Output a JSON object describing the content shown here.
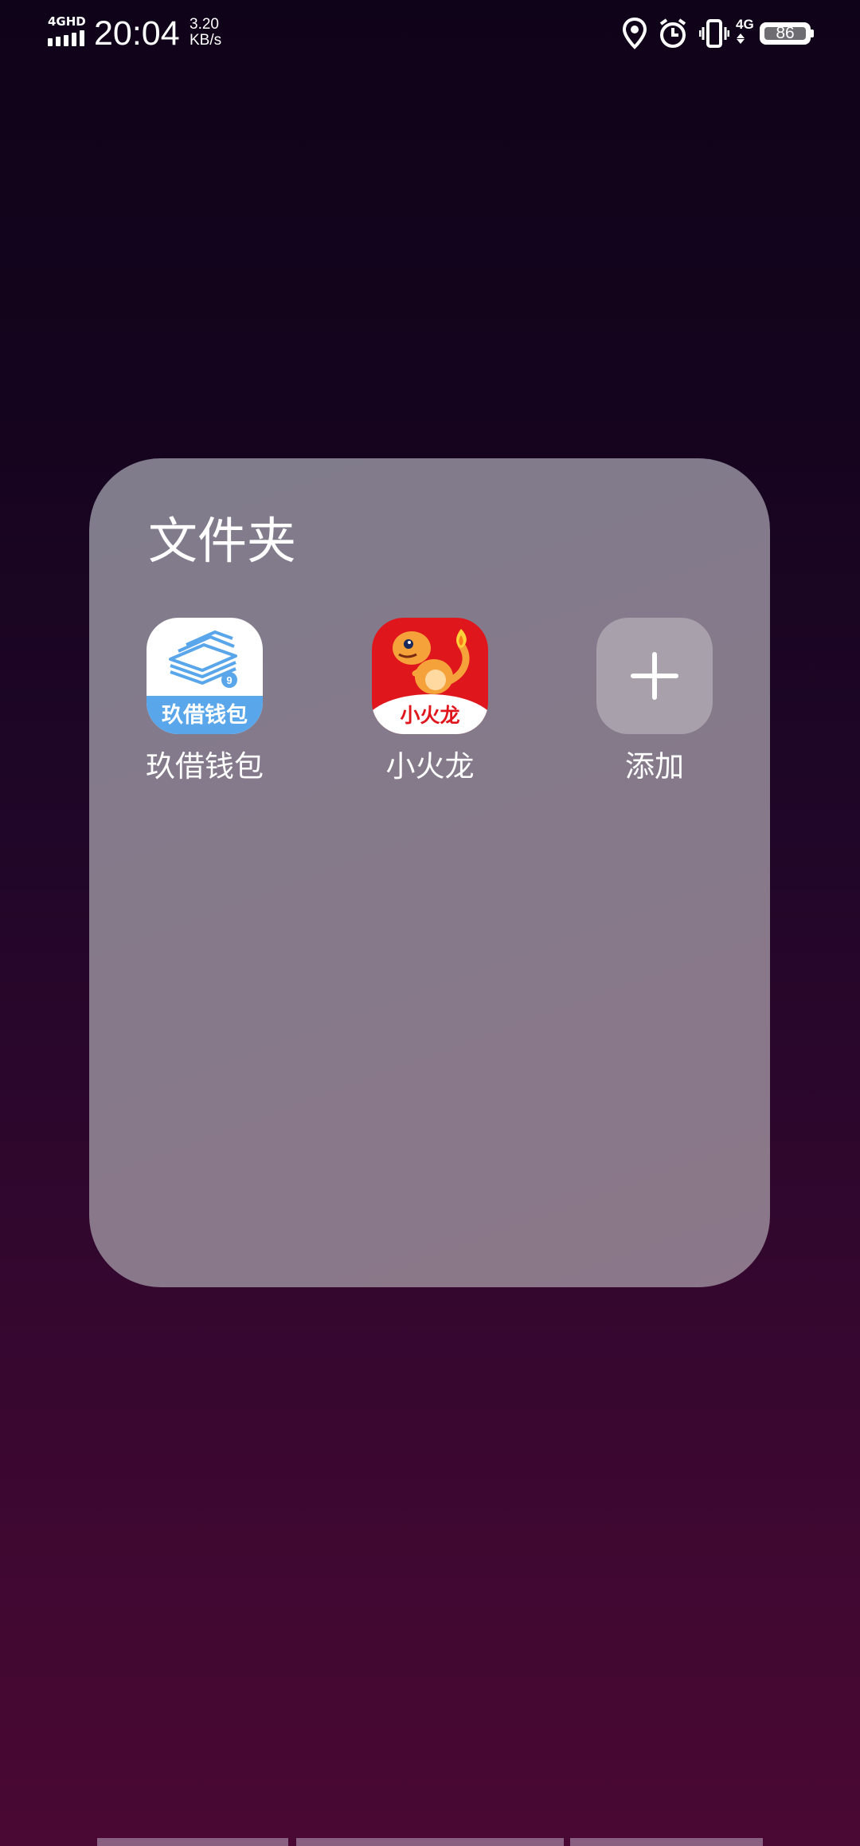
{
  "status_bar": {
    "network_label": "4GHD",
    "time": "20:04",
    "speed_value": "3.20",
    "speed_unit": "KB/s",
    "mobile_data_label": "4G",
    "battery_level": "86",
    "icons": [
      "signal-icon",
      "location-icon",
      "alarm-icon",
      "vibrate-icon",
      "mobile-data-icon",
      "battery-icon"
    ]
  },
  "folder": {
    "title": "文件夹",
    "apps": [
      {
        "label": "玖借钱包",
        "icon_text": "玖借钱包",
        "icon": "jiujie-wallet-app-icon"
      },
      {
        "label": "小火龙",
        "icon_text": "小火龙",
        "icon": "xiaohuolong-app-icon"
      },
      {
        "label": "添加",
        "icon": "plus-icon"
      }
    ]
  },
  "colors": {
    "jiujie_blue": "#5aa6ea",
    "xiaohuolong_red": "#e0161d",
    "folder_bg": "#857a8a"
  }
}
